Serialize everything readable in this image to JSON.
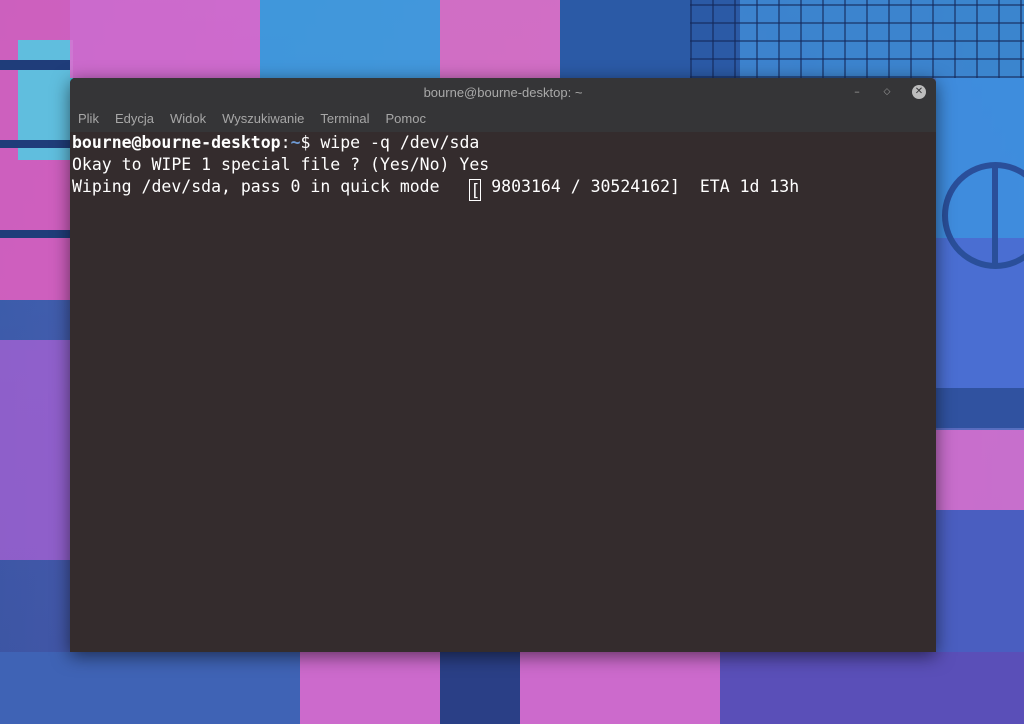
{
  "window": {
    "title": "bourne@bourne-desktop: ~",
    "controls": [
      "minimize-icon",
      "maximize-icon",
      "close-icon"
    ]
  },
  "menu": {
    "items": [
      "Plik",
      "Edycja",
      "Widok",
      "Wyszukiwanie",
      "Terminal",
      "Pomoc"
    ]
  },
  "terminal": {
    "prompt_user_host": "bourne@bourne-desktop",
    "prompt_sep": ":",
    "prompt_path": "~",
    "prompt_symbol": "$ ",
    "command": "wipe -q /dev/sda",
    "line2": "Okay to WIPE 1 special file ? (Yes/No) Yes",
    "line3_prefix": "Wiping /dev/sda, pass 0 in quick mode   ",
    "line3_cursor": "[",
    "line3_suffix": " 9803164 / 30524162]  ETA 1d 13h"
  },
  "colors": {
    "terminal_bg": "#342c2d",
    "titlebar_bg": "#353537",
    "path_color": "#6f9ad3"
  }
}
